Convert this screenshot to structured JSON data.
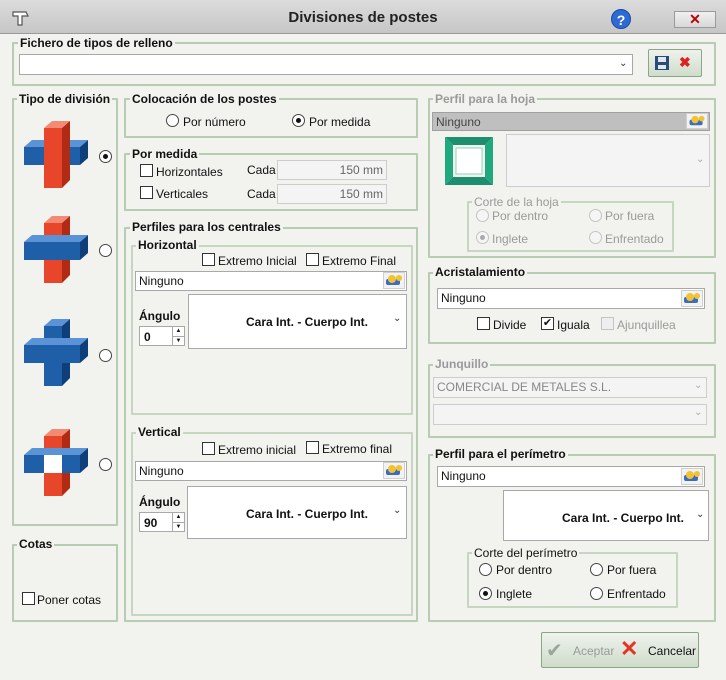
{
  "window": {
    "title": "Divisiones de postes",
    "help": "?",
    "close": "✕"
  },
  "fichero": {
    "title": "Fichero de tipos de relleno",
    "value": ""
  },
  "tipo": {
    "title": "Tipo de división"
  },
  "cotas": {
    "title": "Cotas",
    "poner": "Poner cotas"
  },
  "colocacion": {
    "title": "Colocación de los postes",
    "por_numero": "Por número",
    "por_medida": "Por medida"
  },
  "por_medida": {
    "title": "Por medida",
    "horizontales": "Horizontales",
    "verticales": "Verticales",
    "cada": "Cada",
    "h_value": "150 mm",
    "v_value": "150 mm"
  },
  "centrales": {
    "title": "Perfiles para los centrales",
    "horizontal": {
      "title": "Horizontal",
      "ext_ini": "Extremo Inicial",
      "ext_fin": "Extremo Final",
      "perfil": "Ninguno",
      "angulo_label": "Ángulo",
      "angulo": "0",
      "cara": "Cara Int. - Cuerpo Int."
    },
    "vertical": {
      "title": "Vertical",
      "ext_ini": "Extremo inicial",
      "ext_fin": "Extremo final",
      "perfil": "Ninguno",
      "angulo_label": "Ángulo",
      "angulo": "90",
      "cara": "Cara Int. - Cuerpo Int."
    }
  },
  "hoja": {
    "title": "Perfil para la hoja",
    "perfil": "Ninguno",
    "corte_title": "Corte de la hoja",
    "por_dentro": "Por dentro",
    "por_fuera": "Por fuera",
    "inglete": "Inglete",
    "enfrentado": "Enfrentado"
  },
  "acrist": {
    "title": "Acristalamiento",
    "perfil": "Ninguno",
    "divide": "Divide",
    "iguala": "Iguala",
    "ajunquillea": "Ajunquillea"
  },
  "junquillo": {
    "title": "Junquillo",
    "value": "COMERCIAL DE METALES S.L.",
    "value2": ""
  },
  "perimetro": {
    "title": "Perfil para el perímetro",
    "perfil": "Ninguno",
    "cara": "Cara Int. - Cuerpo Int.",
    "corte_title": "Corte del perímetro",
    "por_dentro": "Por dentro",
    "por_fuera": "Por fuera",
    "inglete": "Inglete",
    "enfrentado": "Enfrentado"
  },
  "footer": {
    "aceptar": "Aceptar",
    "cancelar": "Cancelar"
  },
  "colors": {
    "blue": "#1f5fa8",
    "red": "#e8462b",
    "accent_border": "#b8ccb3"
  }
}
